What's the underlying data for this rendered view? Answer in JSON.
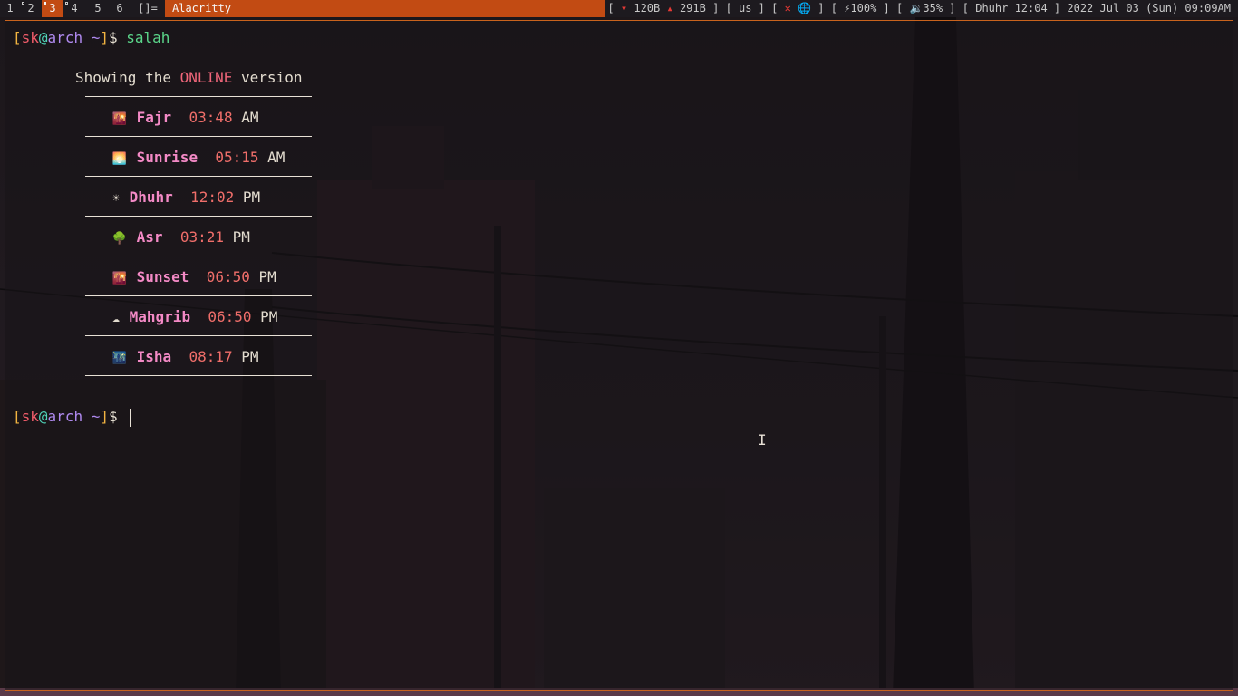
{
  "bar": {
    "tags": [
      "1",
      "2",
      "3",
      "4",
      "5",
      "6"
    ],
    "selected_tag": "3",
    "layout_symbol": "[]=",
    "window_title": "Alacritty",
    "status": {
      "net_open": "[",
      "down_arrow": "▾",
      "down": "120B",
      "up_arrow": "▴",
      "up": "291B",
      "net_close": "]",
      "kbd": "[ us ]",
      "wifi_open": "[",
      "wifi_off": "✕",
      "globe": "🌐",
      "wifi_close": "]",
      "battery": "[ ⚡100% ]",
      "volume": "[ 🔉35% ]",
      "prayer": "[ Dhuhr  12:04 ]",
      "datetime": "2022 Jul 03 (Sun) 09:09AM"
    }
  },
  "terminal": {
    "prompt": {
      "open": "[",
      "user": "sk",
      "at": "@",
      "host": "arch",
      "dir": " ~",
      "close": "]",
      "sigil": "$"
    },
    "command": "salah",
    "header_prefix": "Showing the ",
    "header_mode": "ONLINE",
    "header_suffix": " version",
    "prayers": [
      {
        "icon": "🌇",
        "name": "Fajr",
        "time": "03:48",
        "ampm": "AM"
      },
      {
        "icon": "🌅",
        "name": "Sunrise",
        "time": "05:15",
        "ampm": "AM"
      },
      {
        "icon": "☀",
        "name": "Dhuhr",
        "time": "12:02",
        "ampm": "PM"
      },
      {
        "icon": "🌳",
        "name": "Asr",
        "time": "03:21",
        "ampm": "PM"
      },
      {
        "icon": "🌇",
        "name": "Sunset",
        "time": "06:50",
        "ampm": "PM"
      },
      {
        "icon": "☁",
        "name": "Mahgrib",
        "time": "06:50",
        "ampm": "PM"
      },
      {
        "icon": "🌃",
        "name": "Isha",
        "time": "08:17",
        "ampm": "PM"
      }
    ]
  },
  "colors": {
    "accent": "#c24b13",
    "prayer_name": "#f48ac6",
    "prayer_time": "#f06e6a",
    "command": "#5bd68a"
  }
}
